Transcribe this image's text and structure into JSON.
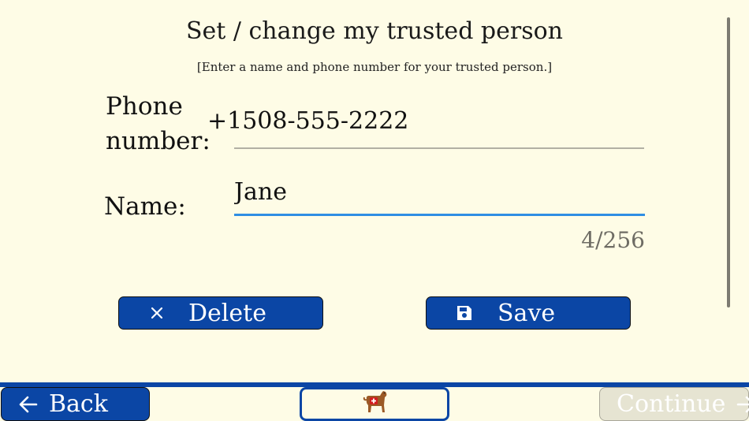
{
  "header": {
    "title": "Set / change my trusted person",
    "subtitle": "[Enter a name and phone number for your trusted person.]"
  },
  "form": {
    "phone_label": "Phone number:",
    "phone_value": "+1508-555-2222",
    "name_label": "Name:",
    "name_value": "Jane",
    "name_counter": "4/256"
  },
  "actions": {
    "delete_label": "Delete",
    "save_label": "Save"
  },
  "nav": {
    "back_label": "Back",
    "continue_label": "Continue",
    "home_icon": "service-dog-icon"
  },
  "colors": {
    "background": "#fefce6",
    "primary": "#0b46a5",
    "focus_underline": "#2f8ee3",
    "disabled_button": "#e6e4d2"
  }
}
